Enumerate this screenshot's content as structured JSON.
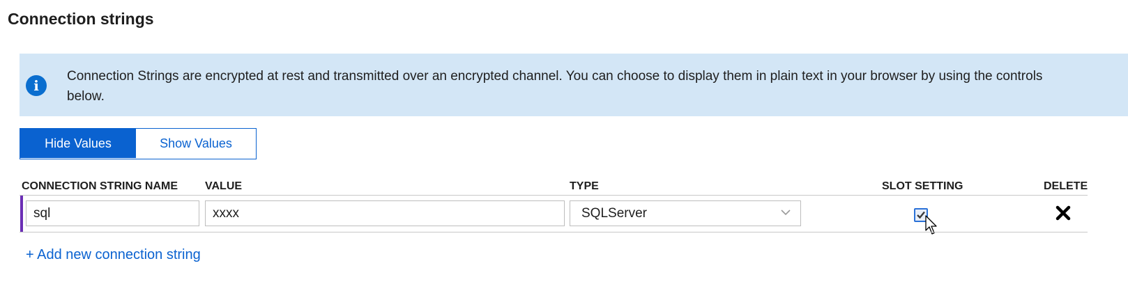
{
  "section": {
    "title": "Connection strings"
  },
  "banner": {
    "icon": "info-icon",
    "icon_glyph": "i",
    "text": "Connection Strings are encrypted at rest and transmitted over an encrypted channel. You can choose to display them in plain text in your browser by using the controls below."
  },
  "toggle": {
    "hide_label": "Hide Values",
    "show_label": "Show Values",
    "selected": "Hide Values",
    "accent_color": "#0a62d0"
  },
  "table": {
    "headers": {
      "name": "CONNECTION STRING NAME",
      "value": "VALUE",
      "type": "TYPE",
      "slot_setting": "SLOT SETTING",
      "delete": "DELETE"
    },
    "rows": [
      {
        "name": "sql",
        "value": "xxxx",
        "type": "SQLServer",
        "slot_setting": true
      }
    ],
    "row_accent_color": "#6b2fb5"
  },
  "actions": {
    "add_label": "+ Add new connection string"
  }
}
